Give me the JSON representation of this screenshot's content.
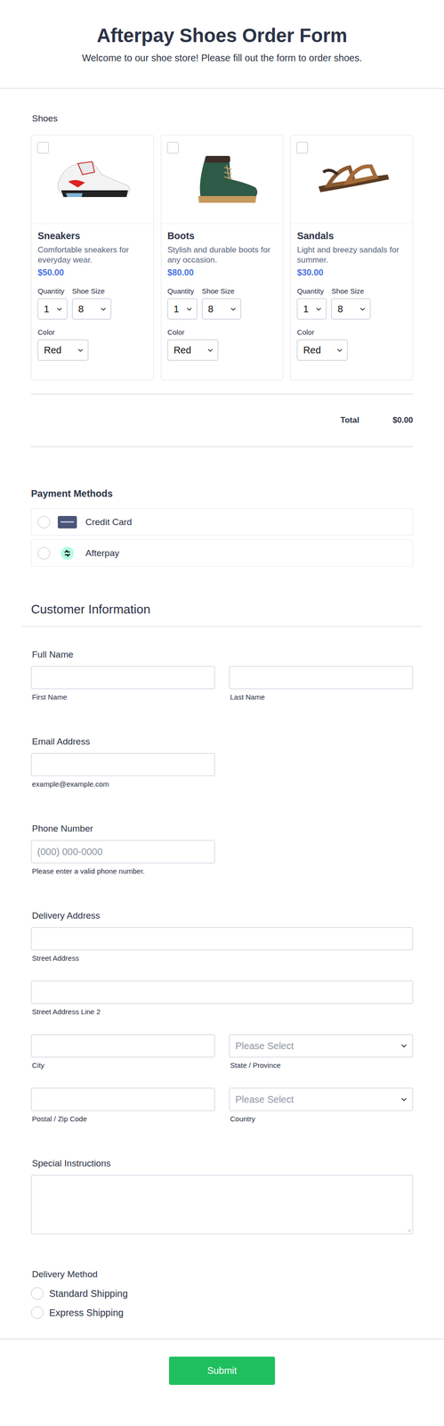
{
  "header": {
    "title": "Afterpay Shoes Order Form",
    "subtitle": "Welcome to our shoe store! Please fill out the form to order shoes."
  },
  "products": {
    "label": "Shoes",
    "items": [
      {
        "kind": "sneaker",
        "name": "Sneakers",
        "description": "Comfortable sneakers for everyday wear.",
        "price": "$50.00",
        "checked": false,
        "quantity_label": "Quantity",
        "quantity": "1",
        "size_label": "Shoe Size",
        "size": "8",
        "color_label": "Color",
        "color": "Red"
      },
      {
        "kind": "boot",
        "name": "Boots",
        "description": "Stylish and durable boots for any occasion.",
        "price": "$80.00",
        "checked": false,
        "quantity_label": "Quantity",
        "quantity": "1",
        "size_label": "Shoe Size",
        "size": "8",
        "color_label": "Color",
        "color": "Red"
      },
      {
        "kind": "sandal",
        "name": "Sandals",
        "description": "Light and breezy sandals for summer.",
        "price": "$30.00",
        "checked": false,
        "quantity_label": "Quantity",
        "quantity": "1",
        "size_label": "Shoe Size",
        "size": "8",
        "color_label": "Color",
        "color": "Red"
      }
    ]
  },
  "total": {
    "label": "Total",
    "value": "$0.00"
  },
  "payment": {
    "title": "Payment Methods",
    "options": [
      {
        "kind": "card",
        "label": "Credit Card",
        "selected": false
      },
      {
        "kind": "afterpay",
        "label": "Afterpay",
        "selected": false
      }
    ]
  },
  "customer": {
    "title": "Customer Information",
    "full_name": {
      "label": "Full Name",
      "first": "First Name",
      "last": "Last Name"
    },
    "email": {
      "label": "Email Address",
      "hint": "example@example.com"
    },
    "phone": {
      "label": "Phone Number",
      "placeholder": "(000) 000-0000",
      "hint": "Please enter a valid phone number."
    },
    "address": {
      "label": "Delivery Address",
      "street": "Street Address",
      "street2": "Street Address Line 2",
      "city": "City",
      "state": {
        "placeholder": "Please Select",
        "sublabel": "State / Province"
      },
      "zip": "Postal / Zip Code",
      "country": {
        "placeholder": "Please Select",
        "sublabel": "Country"
      }
    },
    "instructions": {
      "label": "Special Instructions"
    },
    "delivery": {
      "label": "Delivery Method",
      "options": [
        {
          "label": "Standard Shipping",
          "selected": false
        },
        {
          "label": "Express Shipping",
          "selected": false
        }
      ]
    }
  },
  "submit": "Submit"
}
